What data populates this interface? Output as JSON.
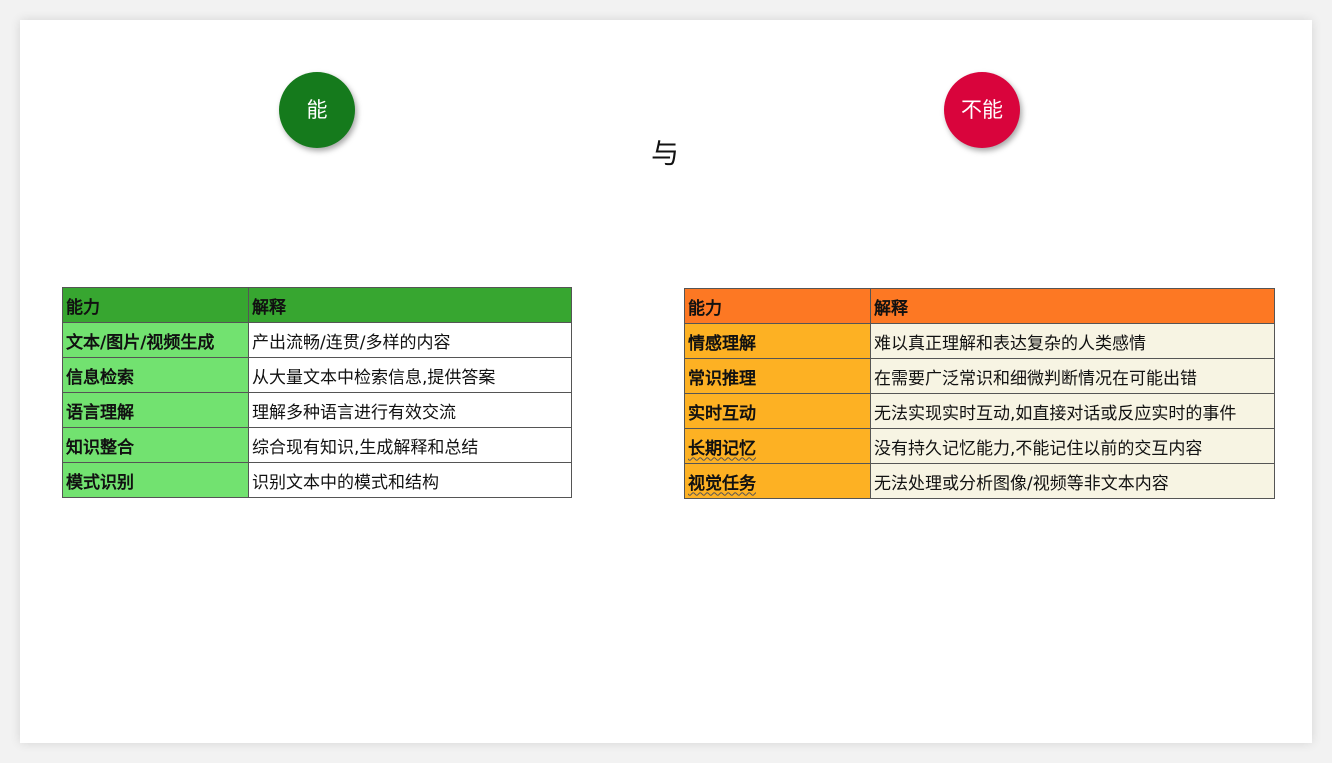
{
  "circles": {
    "can": "能",
    "cannot": "不能"
  },
  "connector": "与",
  "can_table": {
    "headers": [
      "能力",
      "解释"
    ],
    "rows": [
      [
        "文本/图片/视频生成",
        "产出流畅/连贯/多样的内容"
      ],
      [
        "信息检索",
        "从大量文本中检索信息,提供答案"
      ],
      [
        "语言理解",
        "理解多种语言进行有效交流"
      ],
      [
        "知识整合",
        "综合现有知识,生成解释和总结"
      ],
      [
        "模式识别",
        "识别文本中的模式和结构"
      ]
    ]
  },
  "cannot_table": {
    "headers": [
      "能力",
      "解释"
    ],
    "rows": [
      [
        "情感理解",
        "难以真正理解和表达复杂的人类感情"
      ],
      [
        "常识推理",
        "在需要广泛常识和细微判断情况在可能出错"
      ],
      [
        "实时互动",
        "无法实现实时互动,如直接对话或反应实时的事件"
      ],
      [
        "长期记忆",
        "没有持久记忆能力,不能记住以前的交互内容"
      ],
      [
        "视觉任务",
        "无法处理或分析图像/视频等非文本内容"
      ]
    ]
  },
  "colors": {
    "can_circle": "#157a1c",
    "cannot_circle": "#d9043c",
    "can_header": "#37a630",
    "can_key": "#72e270",
    "cannot_header": "#fd7823",
    "cannot_key": "#fdb123",
    "cannot_value": "#f7f4e3"
  }
}
